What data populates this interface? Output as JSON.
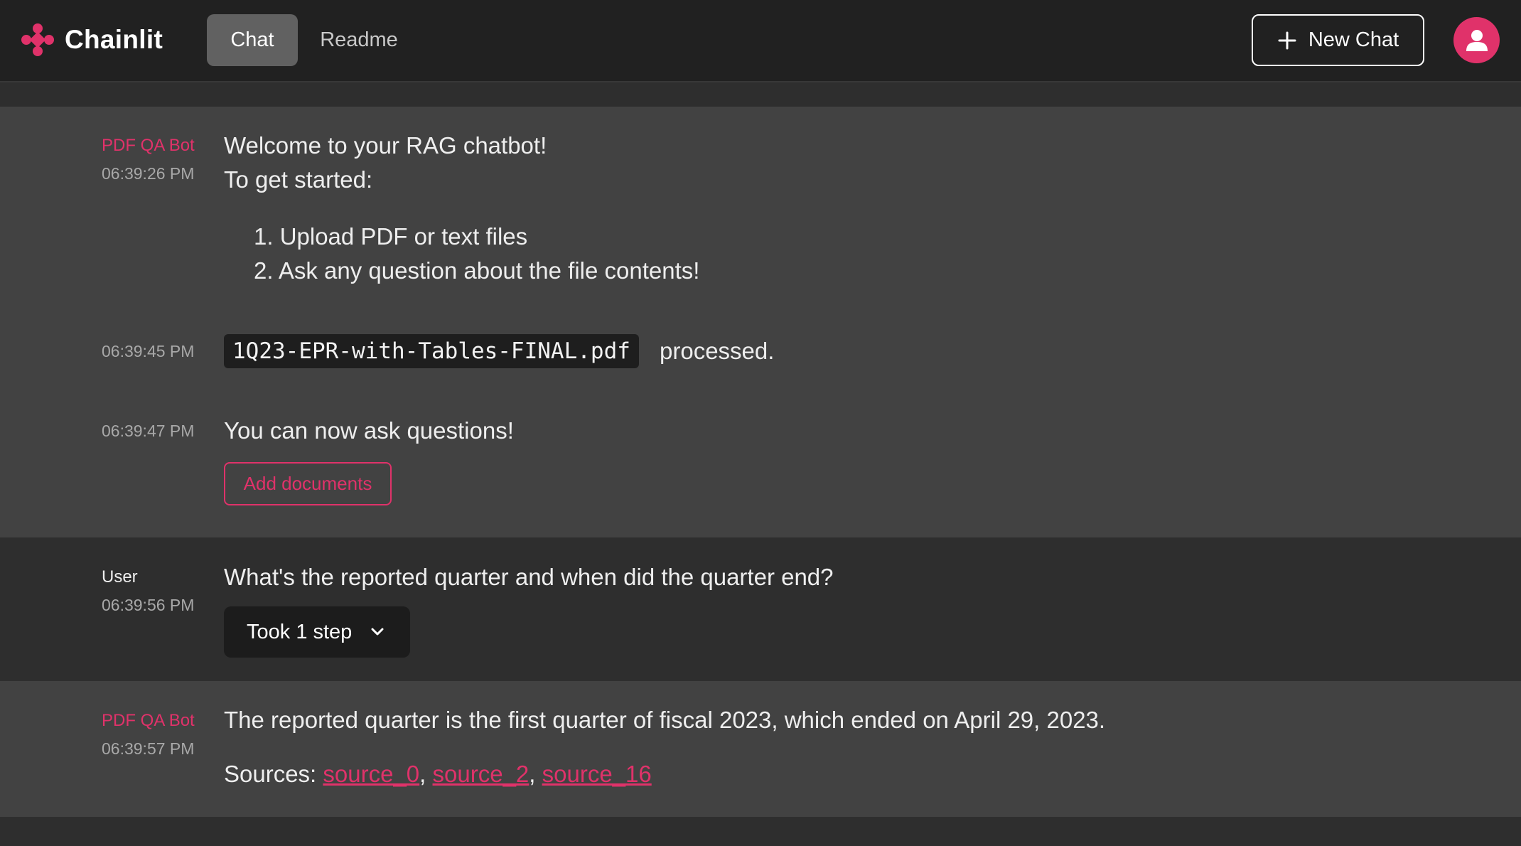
{
  "header": {
    "app_name": "Chainlit",
    "tabs": [
      {
        "label": "Chat",
        "active": true
      },
      {
        "label": "Readme",
        "active": false
      }
    ],
    "new_chat_label": "New Chat",
    "accent_color": "#e0326a"
  },
  "messages": [
    {
      "author": "PDF QA Bot",
      "time": "06:39:26 PM",
      "lines": [
        "Welcome to your RAG chatbot!",
        "To get started:"
      ],
      "list": [
        "1. Upload PDF or text files",
        "2. Ask any question about the file contents!"
      ]
    },
    {
      "time": "06:39:45 PM",
      "file_name": "1Q23-EPR-with-Tables-FINAL.pdf",
      "suffix": "processed."
    },
    {
      "time": "06:39:47 PM",
      "text": "You can now ask questions!",
      "action_label": "Add documents"
    },
    {
      "author": "User",
      "time": "06:39:56 PM",
      "text": "What's the reported quarter and when did the quarter end?",
      "step_label": "Took 1 step"
    },
    {
      "author": "PDF QA Bot",
      "time": "06:39:57 PM",
      "text": "The reported quarter is the first quarter of fiscal 2023, which ended on April 29, 2023.",
      "sources_label": "Sources:",
      "sources": [
        "source_0",
        "source_2",
        "source_16"
      ]
    }
  ]
}
